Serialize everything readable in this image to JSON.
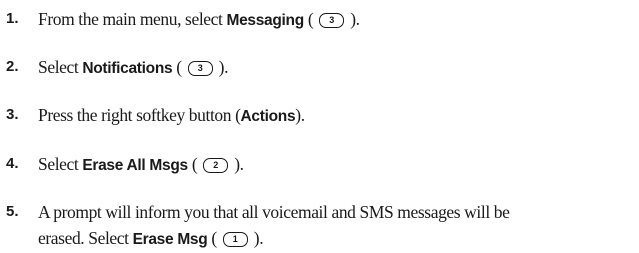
{
  "steps": [
    {
      "number": "1.",
      "before": "From the main menu, select ",
      "keyword": "Messaging",
      "open": " ( ",
      "key": "3",
      "close": " )."
    },
    {
      "number": "2.",
      "before": "Select ",
      "keyword": "Notifications",
      "open": " ( ",
      "key": "3",
      "close": " )."
    },
    {
      "number": "3.",
      "before": "Press the right softkey button (",
      "keyword": "Actions",
      "after": ")."
    },
    {
      "number": "4.",
      "before": "Select ",
      "keyword": "Erase All Msgs",
      "open": " ( ",
      "key": "2",
      "close": " )."
    },
    {
      "number": "5.",
      "line1": "A prompt will inform you that all voicemail and SMS messages will be",
      "before": "erased. Select ",
      "keyword": "Erase Msg",
      "open": " ( ",
      "key": "1",
      "close": " )."
    }
  ]
}
